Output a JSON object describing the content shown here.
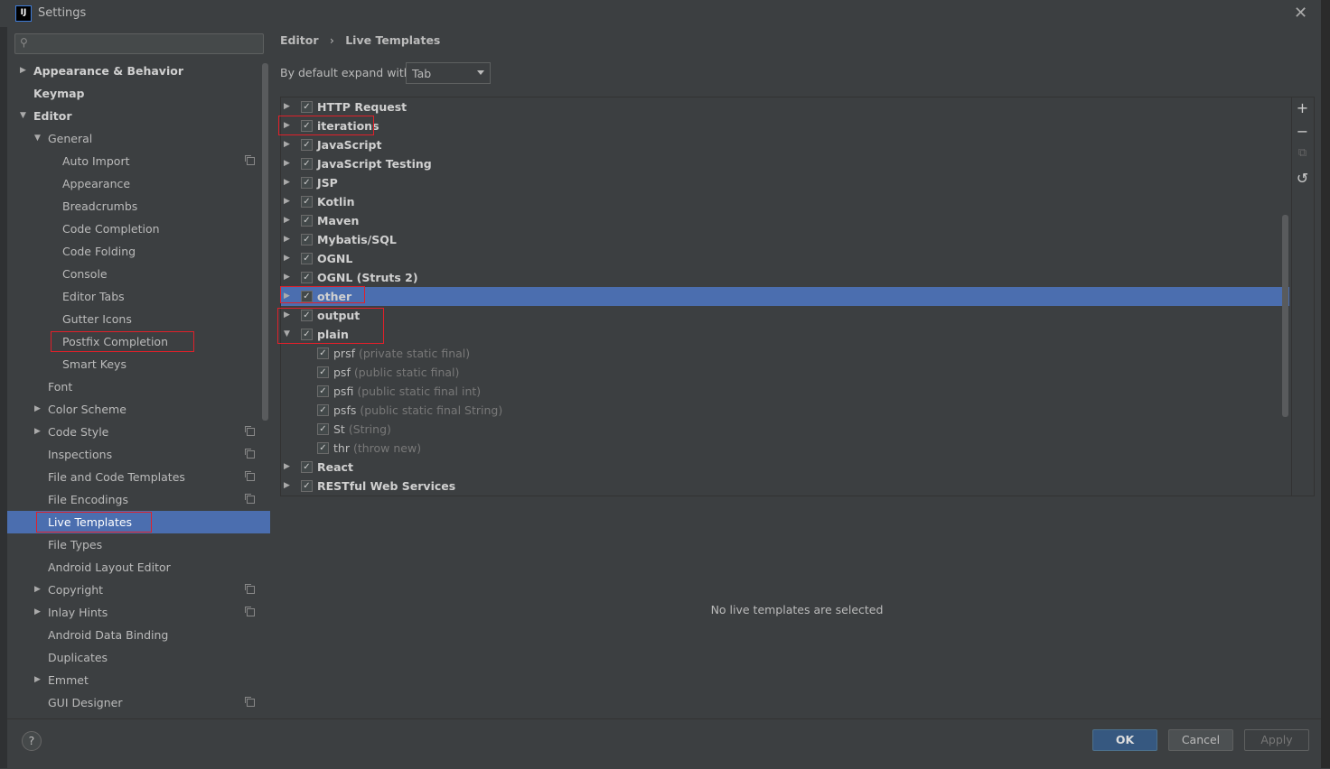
{
  "window": {
    "title": "Settings",
    "close_icon": "close-icon",
    "app_icon_text": "IJ"
  },
  "search": {
    "placeholder": "",
    "value": ""
  },
  "sidebar": {
    "items": [
      {
        "label": "Appearance & Behavior",
        "level": 0,
        "arrow": "right",
        "bold": true
      },
      {
        "label": "Keymap",
        "level": 0,
        "arrow": "none",
        "bold": true
      },
      {
        "label": "Editor",
        "level": 0,
        "arrow": "down",
        "bold": true
      },
      {
        "label": "General",
        "level": 1,
        "arrow": "down"
      },
      {
        "label": "Auto Import",
        "level": 2,
        "arrow": "none",
        "icon": true
      },
      {
        "label": "Appearance",
        "level": 2,
        "arrow": "none"
      },
      {
        "label": "Breadcrumbs",
        "level": 2,
        "arrow": "none"
      },
      {
        "label": "Code Completion",
        "level": 2,
        "arrow": "none"
      },
      {
        "label": "Code Folding",
        "level": 2,
        "arrow": "none"
      },
      {
        "label": "Console",
        "level": 2,
        "arrow": "none"
      },
      {
        "label": "Editor Tabs",
        "level": 2,
        "arrow": "none"
      },
      {
        "label": "Gutter Icons",
        "level": 2,
        "arrow": "none"
      },
      {
        "label": "Postfix Completion",
        "level": 2,
        "arrow": "none",
        "highlighted": true
      },
      {
        "label": "Smart Keys",
        "level": 2,
        "arrow": "none"
      },
      {
        "label": "Font",
        "level": 1,
        "arrow": "none"
      },
      {
        "label": "Color Scheme",
        "level": 1,
        "arrow": "right"
      },
      {
        "label": "Code Style",
        "level": 1,
        "arrow": "right",
        "icon": true
      },
      {
        "label": "Inspections",
        "level": 1,
        "arrow": "none",
        "icon": true
      },
      {
        "label": "File and Code Templates",
        "level": 1,
        "arrow": "none",
        "icon": true
      },
      {
        "label": "File Encodings",
        "level": 1,
        "arrow": "none",
        "icon": true
      },
      {
        "label": "Live Templates",
        "level": 1,
        "arrow": "none",
        "selected": true,
        "highlighted": true
      },
      {
        "label": "File Types",
        "level": 1,
        "arrow": "none"
      },
      {
        "label": "Android Layout Editor",
        "level": 1,
        "arrow": "none"
      },
      {
        "label": "Copyright",
        "level": 1,
        "arrow": "right",
        "icon": true
      },
      {
        "label": "Inlay Hints",
        "level": 1,
        "arrow": "right",
        "icon": true
      },
      {
        "label": "Android Data Binding",
        "level": 1,
        "arrow": "none"
      },
      {
        "label": "Duplicates",
        "level": 1,
        "arrow": "none"
      },
      {
        "label": "Emmet",
        "level": 1,
        "arrow": "right"
      },
      {
        "label": "GUI Designer",
        "level": 1,
        "arrow": "none",
        "icon": true
      }
    ]
  },
  "main": {
    "breadcrumb": {
      "parent": "Editor",
      "separator": "›",
      "current": "Live Templates"
    },
    "expand_label": "By default expand with",
    "expand_value": "Tab",
    "groups": [
      {
        "name": "HTTP Request",
        "checked": true,
        "expanded": false
      },
      {
        "name": "iterations",
        "checked": true,
        "expanded": false
      },
      {
        "name": "JavaScript",
        "checked": true,
        "expanded": false
      },
      {
        "name": "JavaScript Testing",
        "checked": true,
        "expanded": false
      },
      {
        "name": "JSP",
        "checked": true,
        "expanded": false
      },
      {
        "name": "Kotlin",
        "checked": true,
        "expanded": false
      },
      {
        "name": "Maven",
        "checked": true,
        "expanded": false
      },
      {
        "name": "Mybatis/SQL",
        "checked": true,
        "expanded": false
      },
      {
        "name": "OGNL",
        "checked": true,
        "expanded": false
      },
      {
        "name": "OGNL (Struts 2)",
        "checked": true,
        "expanded": false
      },
      {
        "name": "other",
        "checked": true,
        "expanded": false,
        "selected": true
      },
      {
        "name": "output",
        "checked": true,
        "expanded": false
      },
      {
        "name": "plain",
        "checked": true,
        "expanded": true,
        "templates": [
          {
            "abbr": "prsf",
            "desc": "(private static final)",
            "checked": true
          },
          {
            "abbr": "psf",
            "desc": "(public static final)",
            "checked": true
          },
          {
            "abbr": "psfi",
            "desc": "(public static final int)",
            "checked": true
          },
          {
            "abbr": "psfs",
            "desc": "(public static final String)",
            "checked": true
          },
          {
            "abbr": "St",
            "desc": "(String)",
            "checked": true
          },
          {
            "abbr": "thr",
            "desc": "(throw new)",
            "checked": true
          }
        ]
      },
      {
        "name": "React",
        "checked": true,
        "expanded": false
      },
      {
        "name": "RESTful Web Services",
        "checked": true,
        "expanded": false
      }
    ],
    "toolbar": {
      "add": "+",
      "remove": "−",
      "copy": "⧉",
      "restore": "↺"
    },
    "empty_message": "No live templates are selected"
  },
  "footer": {
    "help": "?",
    "ok": "OK",
    "cancel": "Cancel",
    "apply": "Apply"
  },
  "colors": {
    "selection": "#4b6eaf",
    "background": "#3c3f41",
    "annotation": "#e0202a",
    "ok_button": "#365880"
  }
}
